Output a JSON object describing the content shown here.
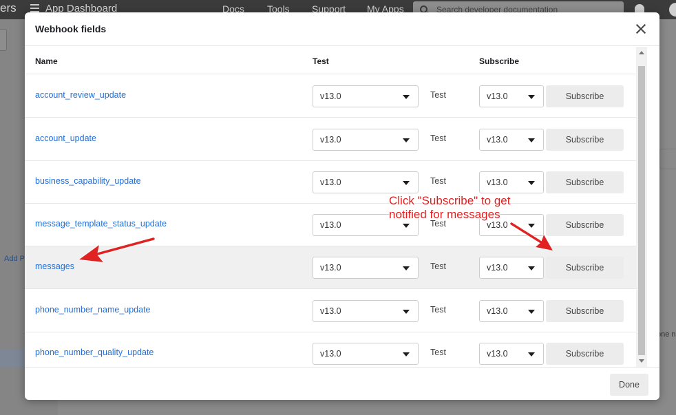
{
  "background": {
    "brand_tail": "ers",
    "app_title": "App Dashboard",
    "nav": [
      "Docs",
      "Tools",
      "Support",
      "My Apps"
    ],
    "search_placeholder": "Search developer documentation",
    "left_link": "Add P",
    "right_text": "one n"
  },
  "modal": {
    "title": "Webhook fields",
    "columns": {
      "name": "Name",
      "test": "Test",
      "subscribe": "Subscribe"
    },
    "rows": [
      {
        "name": "account_review_update",
        "test_version": "v13.0",
        "test_label": "Test",
        "sub_version": "v13.0",
        "sub_label": "Subscribe"
      },
      {
        "name": "account_update",
        "test_version": "v13.0",
        "test_label": "Test",
        "sub_version": "v13.0",
        "sub_label": "Subscribe"
      },
      {
        "name": "business_capability_update",
        "test_version": "v13.0",
        "test_label": "Test",
        "sub_version": "v13.0",
        "sub_label": "Subscribe"
      },
      {
        "name": "message_template_status_update",
        "test_version": "v13.0",
        "test_label": "Test",
        "sub_version": "v13.0",
        "sub_label": "Subscribe"
      },
      {
        "name": "messages",
        "test_version": "v13.0",
        "test_label": "Test",
        "sub_version": "v13.0",
        "sub_label": "Subscribe"
      },
      {
        "name": "phone_number_name_update",
        "test_version": "v13.0",
        "test_label": "Test",
        "sub_version": "v13.0",
        "sub_label": "Subscribe"
      },
      {
        "name": "phone_number_quality_update",
        "test_version": "v13.0",
        "test_label": "Test",
        "sub_version": "v13.0",
        "sub_label": "Subscribe"
      }
    ],
    "done_label": "Done"
  },
  "annotation": {
    "line1": "Click \"Subscribe\" to get",
    "line2": "notified for messages"
  },
  "colors": {
    "link": "#216fdb",
    "annotation": "#e02020",
    "highlight_row": "#f0f0f0"
  }
}
